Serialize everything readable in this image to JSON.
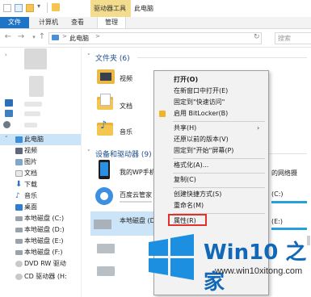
{
  "window": {
    "context_tab_group": "驱动器工具",
    "title": "此电脑"
  },
  "ribbon": {
    "tabs": [
      {
        "label": "文件"
      },
      {
        "label": "计算机"
      },
      {
        "label": "查看"
      },
      {
        "label": "管理"
      }
    ]
  },
  "address_bar": {
    "path": "此电脑",
    "separator": ">",
    "search_placeholder": "搜索"
  },
  "sidebar": {
    "items": [
      {
        "label": "此电脑",
        "selected": true
      },
      {
        "label": "视频"
      },
      {
        "label": "图片"
      },
      {
        "label": "文档"
      },
      {
        "label": "下载"
      },
      {
        "label": "音乐"
      },
      {
        "label": "桌面"
      },
      {
        "label": "本地磁盘 (C:)"
      },
      {
        "label": "本地磁盘 (D:)"
      },
      {
        "label": "本地磁盘 (E:)"
      },
      {
        "label": "本地磁盘 (F:)"
      },
      {
        "label": "DVD RW 驱动"
      },
      {
        "label": "CD 驱动器 (H:"
      }
    ]
  },
  "content": {
    "folders_header": "文件夹 (6)",
    "folders": [
      {
        "label": "视频"
      },
      {
        "label": "文档"
      },
      {
        "label": "音乐"
      }
    ],
    "drives_header": "设备和驱动器 (9)",
    "devices": [
      {
        "label": "我的WP手机"
      },
      {
        "label": "百度云管家"
      },
      {
        "label": "本地磁盘 (D:)"
      }
    ],
    "right_partial": [
      {
        "label": "的网络摄"
      },
      {
        "label": "(C:)"
      },
      {
        "label": "(E:)"
      }
    ]
  },
  "context_menu": {
    "items": [
      {
        "label": "打开(O)",
        "bold": true
      },
      {
        "label": "在新窗口中打开(E)"
      },
      {
        "label": "固定到\"快速访问\""
      },
      {
        "label": "启用 BitLocker(B)"
      },
      {
        "label": "共享(H)",
        "submenu": true
      },
      {
        "label": "还原以前的版本(V)"
      },
      {
        "label": "固定到\"开始\"屏幕(P)"
      },
      {
        "label": "格式化(A)..."
      },
      {
        "label": "复制(C)"
      },
      {
        "label": "创建快捷方式(S)"
      },
      {
        "label": "重命名(M)"
      },
      {
        "label": "属性(R)",
        "highlighted": true
      }
    ]
  },
  "watermark": {
    "title": "Win10 之家",
    "url": "www.win10xitong.com"
  },
  "colors": {
    "accent": "#1e74c7",
    "context_tab": "#f3dc8e",
    "selection": "#cce4f7",
    "highlight_box": "#e2312c",
    "watermark_blue": "#1167b8"
  }
}
